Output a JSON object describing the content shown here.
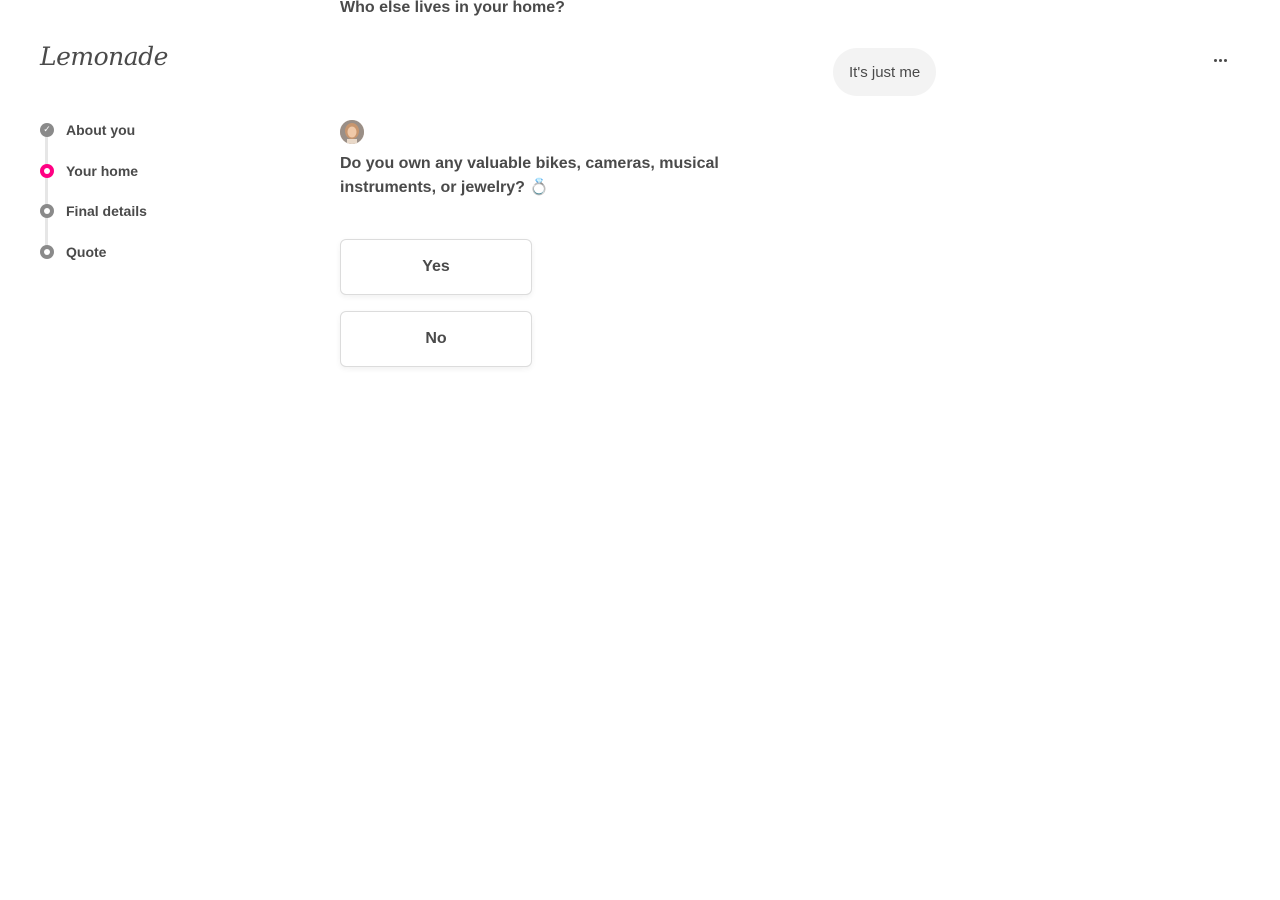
{
  "brand": {
    "logo_text": "Lemonade",
    "accent_color": "#ff0083"
  },
  "menu": {
    "icon": "more-dots-icon"
  },
  "progress": {
    "steps": [
      {
        "label": "About you",
        "state": "done"
      },
      {
        "label": "Your home",
        "state": "active"
      },
      {
        "label": "Final details",
        "state": "pending"
      },
      {
        "label": "Quote",
        "state": "pending"
      }
    ]
  },
  "chat": {
    "previous_question": "Who else lives in your home?",
    "previous_answer": "It's just me",
    "current_question": "Do you own any valuable bikes, cameras, musical instruments, or jewelry? 💍",
    "options": {
      "yes_label": "Yes",
      "no_label": "No"
    }
  }
}
